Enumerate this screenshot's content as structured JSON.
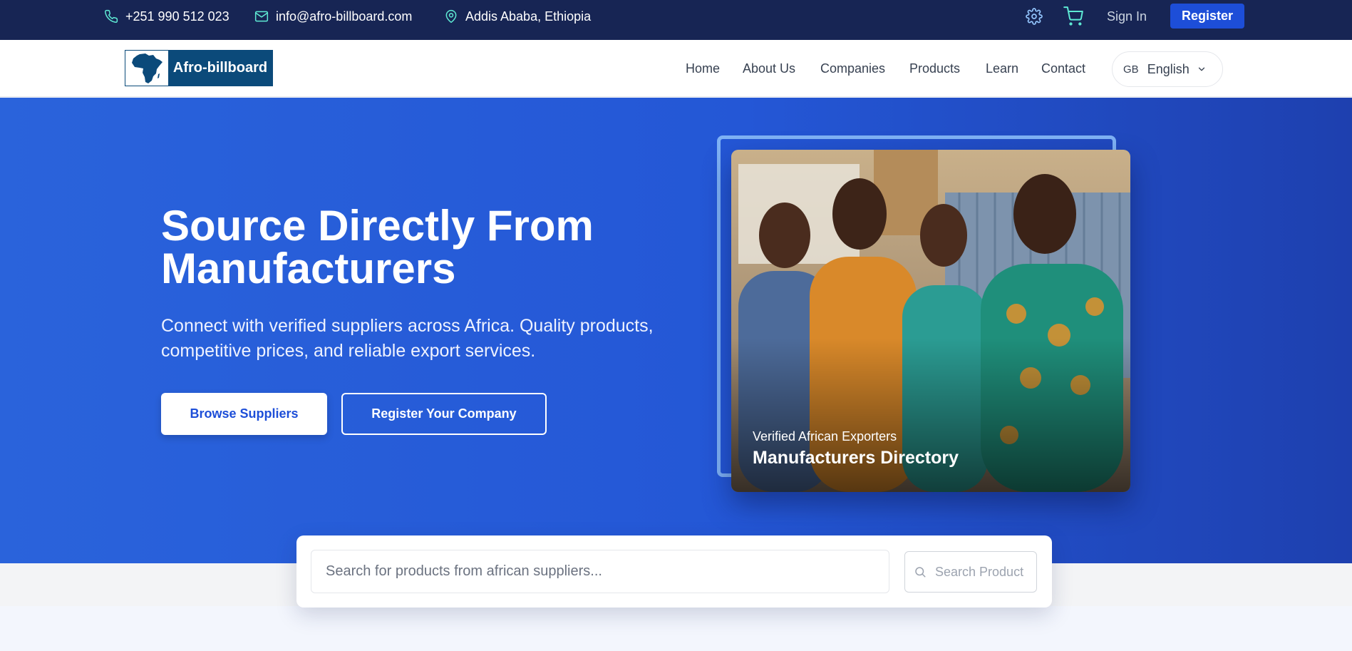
{
  "topbar": {
    "phone": "+251 990 512 023",
    "email": "info@afro-billboard.com",
    "location": "Addis Ababa, Ethiopia",
    "icons": [
      "phone-icon",
      "mail-icon",
      "map-pin-icon",
      "gear-icon",
      "cart-icon"
    ],
    "sign_in": "Sign In",
    "register": "Register"
  },
  "navbar": {
    "logo_text": "Afro-billboard",
    "links": [
      "Home",
      "About Us",
      "Companies",
      "Products",
      "Learn",
      "Contact"
    ],
    "language": {
      "code": "GB",
      "name": "English"
    }
  },
  "hero": {
    "title": "Source Directly From Manufacturers",
    "subtitle": "Connect with verified suppliers across Africa. Quality products, competitive prices, and reliable export services.",
    "primary_button": "Browse Suppliers",
    "secondary_button": "Register Your Company",
    "image": {
      "caption_small": "Verified African Exporters",
      "caption_large": "Manufacturers Directory"
    }
  },
  "search": {
    "placeholder": "Search for products from african suppliers...",
    "button_label": "Search Product"
  },
  "colors": {
    "topbar_bg": "#172554",
    "accent": "#1d4ed8",
    "hero_bg": "#2a63db",
    "logo_bg": "#0b4a7a",
    "icon_teal": "#5eead4"
  }
}
